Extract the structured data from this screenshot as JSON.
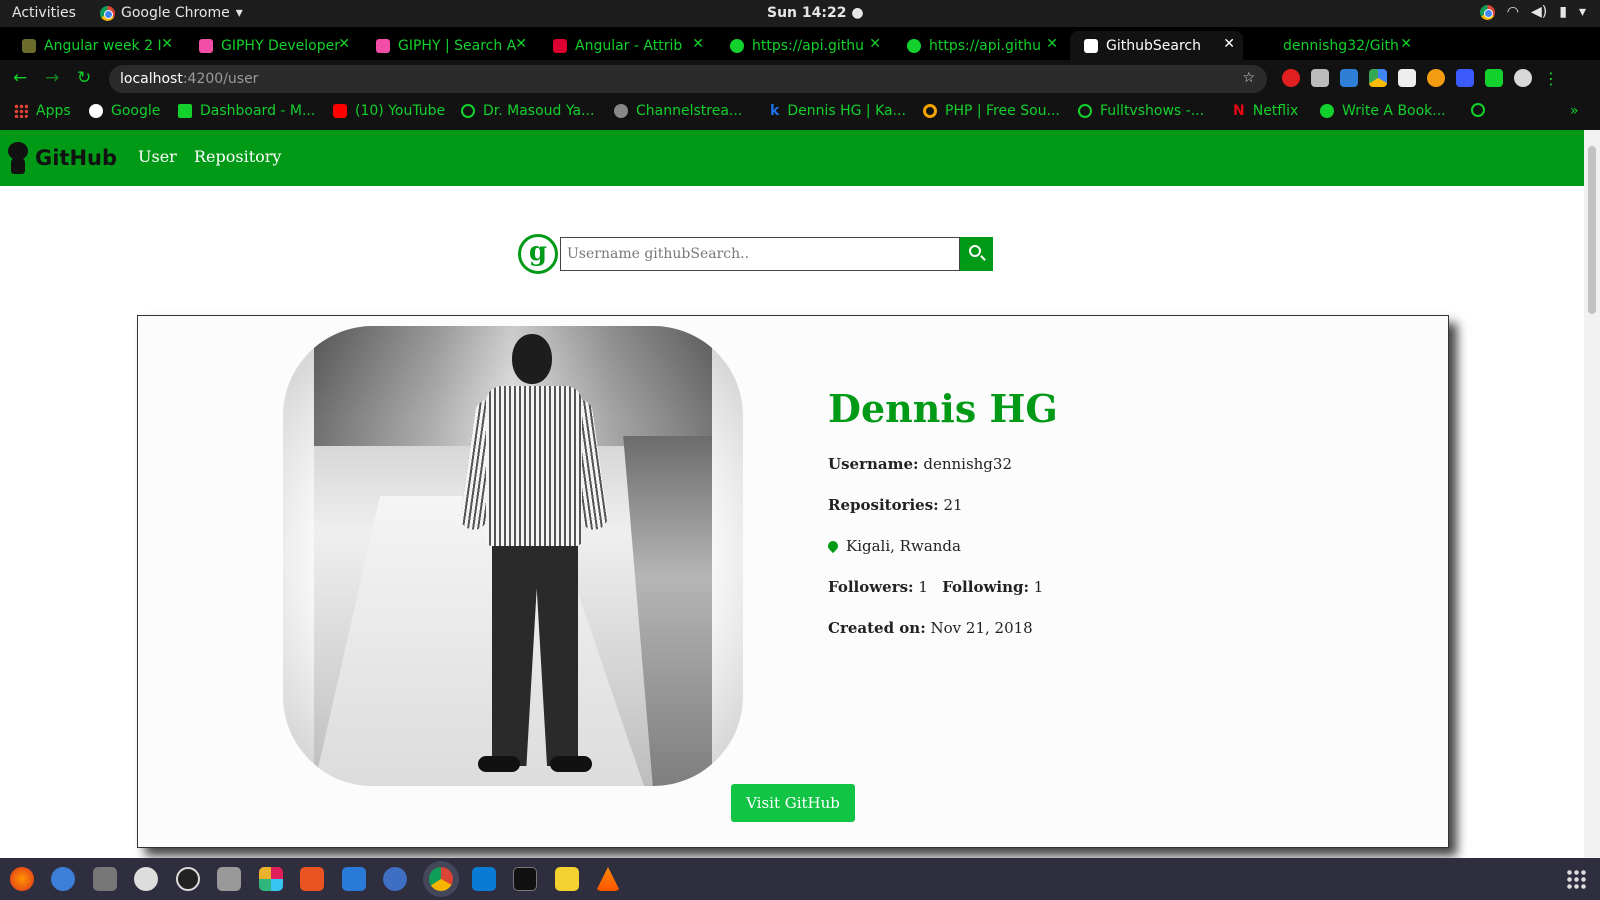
{
  "topbar": {
    "activities": "Activities",
    "app_name": "Google Chrome",
    "clock": "Sun 14:22 ●"
  },
  "tabs": [
    {
      "title": "Angular week 2 I",
      "icon_color": "#6b6b2b",
      "active": false
    },
    {
      "title": "GIPHY Developer",
      "icon_color": "#f24ea7",
      "active": false
    },
    {
      "title": "GIPHY | Search A",
      "icon_color": "#f24ea7",
      "active": false
    },
    {
      "title": "Angular - Attrib",
      "icon_color": "#dd0031",
      "active": false
    },
    {
      "title": "https://api.githu",
      "icon_color": "#12d12c",
      "active": false
    },
    {
      "title": "https://api.githu",
      "icon_color": "#12d12c",
      "active": false
    },
    {
      "title": "GithubSearch",
      "icon_color": "#ffffff",
      "active": true
    },
    {
      "title": "dennishg32/Gith",
      "icon_color": "#000000",
      "active": false
    }
  ],
  "address": {
    "host": "localhost",
    "path": ":4200/user"
  },
  "bookmarks": [
    {
      "label": "Apps",
      "color": "#e94235"
    },
    {
      "label": "Google",
      "color": "#ffffff"
    },
    {
      "label": "Dashboard - M...",
      "color": "#12d12c"
    },
    {
      "label": "(10) YouTube",
      "color": "#ff0000"
    },
    {
      "label": "Dr. Masoud Ya...",
      "color": "#12d12c"
    },
    {
      "label": "Channelstrea...",
      "color": "#888888"
    },
    {
      "label": "Dennis HG | Ka...",
      "color": "#1a73e8"
    },
    {
      "label": "PHP | Free Sou...",
      "color": "#f4a300"
    },
    {
      "label": "Fulltvshows -...",
      "color": "#12d12c"
    },
    {
      "label": "Netflix",
      "color": "#e50914"
    },
    {
      "label": "Write A Book...",
      "color": "#12d12c"
    }
  ],
  "nav": {
    "brand": "GitHub",
    "links": [
      "User",
      "Repository"
    ]
  },
  "search": {
    "logo_letter": "g",
    "placeholder": "Username githubSearch.."
  },
  "profile": {
    "name": "Dennis HG",
    "username_label": "Username:",
    "username": "dennishg32",
    "repos_label": "Repositories:",
    "repos": "21",
    "location": "Kigali, Rwanda",
    "followers_label": "Followers:",
    "followers": "1",
    "following_label": "Following:",
    "following": "1",
    "created_label": "Created on:",
    "created": "Nov 21, 2018",
    "button": "Visit GitHub"
  },
  "colors": {
    "brand_green": "#009A17",
    "button_green": "#11C443",
    "tab_text": "#12d12c"
  }
}
